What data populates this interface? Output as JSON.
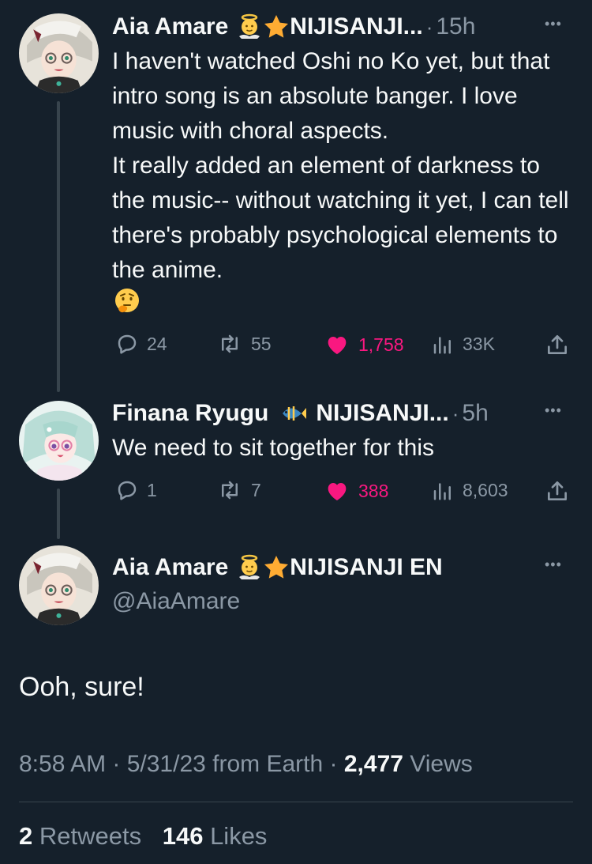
{
  "tweet1": {
    "name": "Aia Amare",
    "name_suffix": "NIJISANJI...",
    "time": "15h",
    "text": "I haven't watched Oshi no Ko yet, but that intro song is an absolute banger. I love music with choral aspects.\nIt really added an element of darkness to the music-- without watching it yet, I can tell there's probably psychological elements to the anime.",
    "stats": {
      "replies": "24",
      "retweets": "55",
      "likes": "1,758",
      "views": "33K"
    }
  },
  "tweet2": {
    "name": "Finana Ryugu",
    "name_suffix": "NIJISANJI...",
    "time": "5h",
    "text": "We need to sit together for this",
    "stats": {
      "replies": "1",
      "retweets": "7",
      "likes": "388",
      "views": "8,603"
    }
  },
  "main": {
    "name": "Aia Amare",
    "name_suffix": "NIJISANJI EN",
    "handle": "@AiaAmare",
    "text": "Ooh, sure!",
    "timestamp": "8:58 AM · 5/31/23 from Earth · ",
    "views_count": "2,477",
    "views_label": " Views",
    "retweets_count": "2",
    "retweets_label": " Retweets",
    "likes_count": "146",
    "likes_label": " Likes"
  },
  "ui": {
    "separator": "·",
    "more": "•••"
  },
  "colors": {
    "background": "#15202b",
    "like": "#f91880",
    "muted": "#8b98a5"
  },
  "icons": [
    "halo-baby-emoji",
    "star-emoji",
    "fish-emoji",
    "thinking-face-emoji",
    "reply-icon",
    "retweet-icon",
    "heart-icon",
    "views-icon",
    "share-icon",
    "more-icon"
  ]
}
